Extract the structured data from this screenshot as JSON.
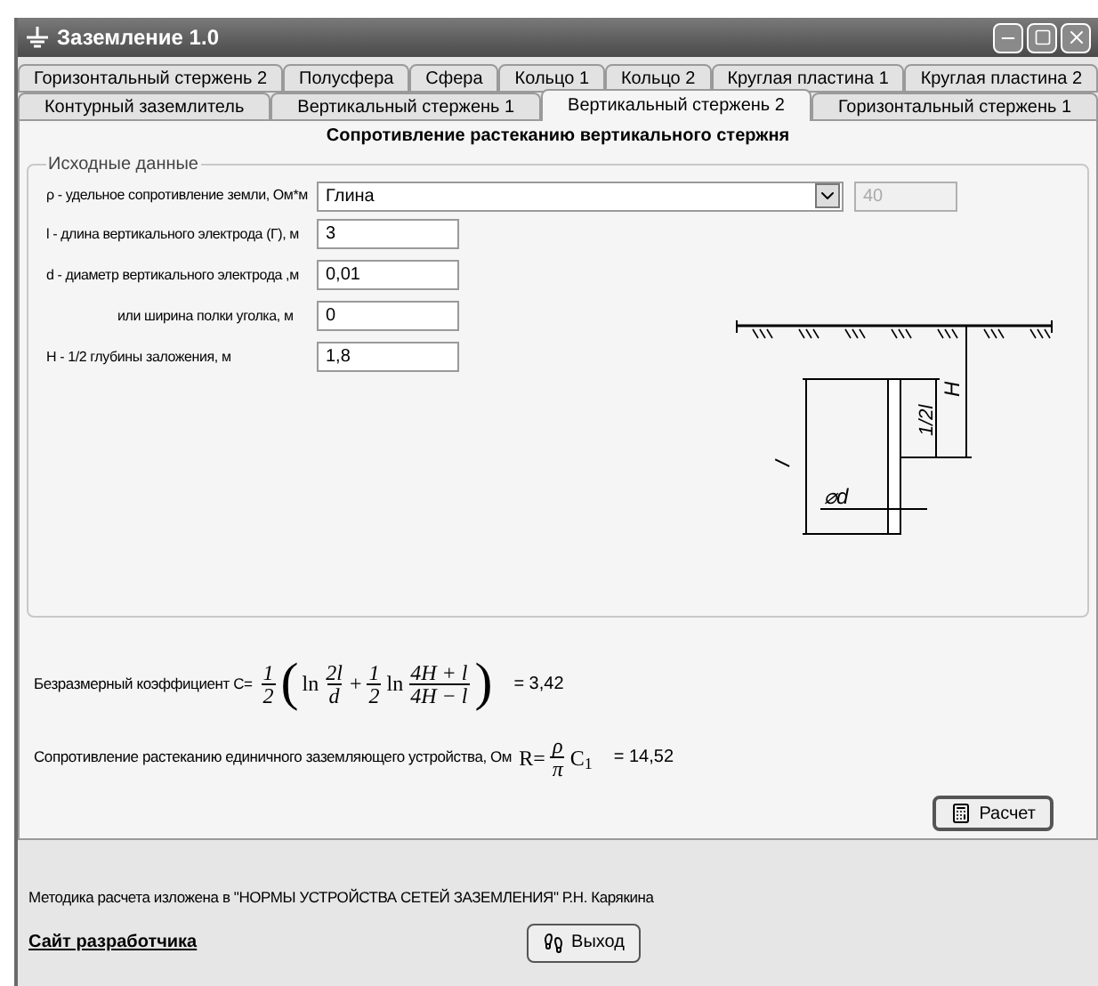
{
  "window": {
    "title": "Заземление 1.0"
  },
  "tab_rows": [
    {
      "tabs": [
        {
          "label": "Горизонтальный стержень 2",
          "selected": false
        },
        {
          "label": "Полусфера",
          "selected": false
        },
        {
          "label": "Сфера",
          "selected": false
        },
        {
          "label": "Кольцо 1",
          "selected": false
        },
        {
          "label": "Кольцо 2",
          "selected": false
        },
        {
          "label": "Круглая пластина 1",
          "selected": false
        },
        {
          "label": "Круглая пластина 2",
          "selected": false
        }
      ]
    },
    {
      "tabs": [
        {
          "label": "Контурный заземлитель",
          "selected": false
        },
        {
          "label": "Вертикальный стержень 1",
          "selected": false
        },
        {
          "label": "Вертикальный стержень 2",
          "selected": true
        },
        {
          "label": "Горизонтальный стержень 1",
          "selected": false
        }
      ]
    }
  ],
  "panel": {
    "heading": "Сопротивление растеканию вертикального стержня"
  },
  "inputs": {
    "group_title": "Исходные данные",
    "soil": {
      "label": "ρ - удельное сопротивление земли, Ом*м",
      "value": "Глина",
      "resistivity": "40",
      "resistivity_disabled": true
    },
    "fields": [
      {
        "label": "l - длина вертикального электрода (Г), м",
        "value": "3",
        "indented": false
      },
      {
        "label": "d - диаметр вертикального электрода ,м",
        "value": "0,01",
        "indented": false
      },
      {
        "label": "или ширина полки уголка, м",
        "value": "0",
        "indented": true
      },
      {
        "label": "H - 1/2 глубины заложения, м",
        "value": "1,8",
        "indented": false
      }
    ]
  },
  "diagram": {
    "labels": {
      "length": "l",
      "half_length": "1/2l",
      "depth": "H",
      "diameter": "⌀d"
    }
  },
  "results": [
    {
      "label": "Безразмерный коэффициент С=",
      "formula": [
        {
          "kind": "frac",
          "num": "1",
          "den": "2"
        },
        {
          "kind": "open",
          "text": "("
        },
        {
          "kind": "text",
          "text": "ln"
        },
        {
          "kind": "frac",
          "num": "2l",
          "den": "d"
        },
        {
          "kind": "text",
          "text": "+"
        },
        {
          "kind": "frac",
          "num": "1",
          "den": "2"
        },
        {
          "kind": "text",
          "text": "ln"
        },
        {
          "kind": "frac",
          "num": "4H + l",
          "den": "4H − l"
        },
        {
          "kind": "close",
          "text": ")"
        }
      ],
      "value": "=  3,42"
    },
    {
      "label": "Сопротивление растеканию единичного заземляющего устройства, Ом",
      "formula": [
        {
          "kind": "text",
          "text": "R="
        },
        {
          "kind": "frac",
          "num": "ρ",
          "den": "π"
        },
        {
          "kind": "text",
          "text": "C$_{1}$"
        }
      ],
      "value": "=  14,52"
    }
  ],
  "calc_button": "Расчет",
  "footer": {
    "note": "Методика расчета изложена в \"НОРМЫ УСТРОЙСТВА СЕТЕЙ ЗАЗЕМЛЕНИЯ\" Р.Н. Карякина",
    "link": "Сайт разработчика",
    "exit_button": "Выход"
  }
}
